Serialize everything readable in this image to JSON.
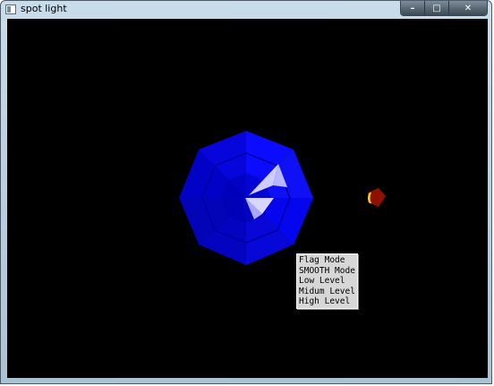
{
  "window": {
    "title": "spot light",
    "controls": {
      "minimize": "–",
      "maximize": "□",
      "close": "✕"
    }
  },
  "menu": {
    "items": [
      {
        "label": "Flag Mode"
      },
      {
        "label": "SMOOTH Mode"
      },
      {
        "label": "Low Level"
      },
      {
        "label": "Midum Level"
      },
      {
        "label": "High Level"
      }
    ]
  },
  "colors": {
    "background": "#000000",
    "sphere_primary": "#0a0aff",
    "sphere_dark": "#0000a8",
    "highlight": "#ccccff",
    "light_body": "#8b1200",
    "light_glow": "#ffd200"
  }
}
